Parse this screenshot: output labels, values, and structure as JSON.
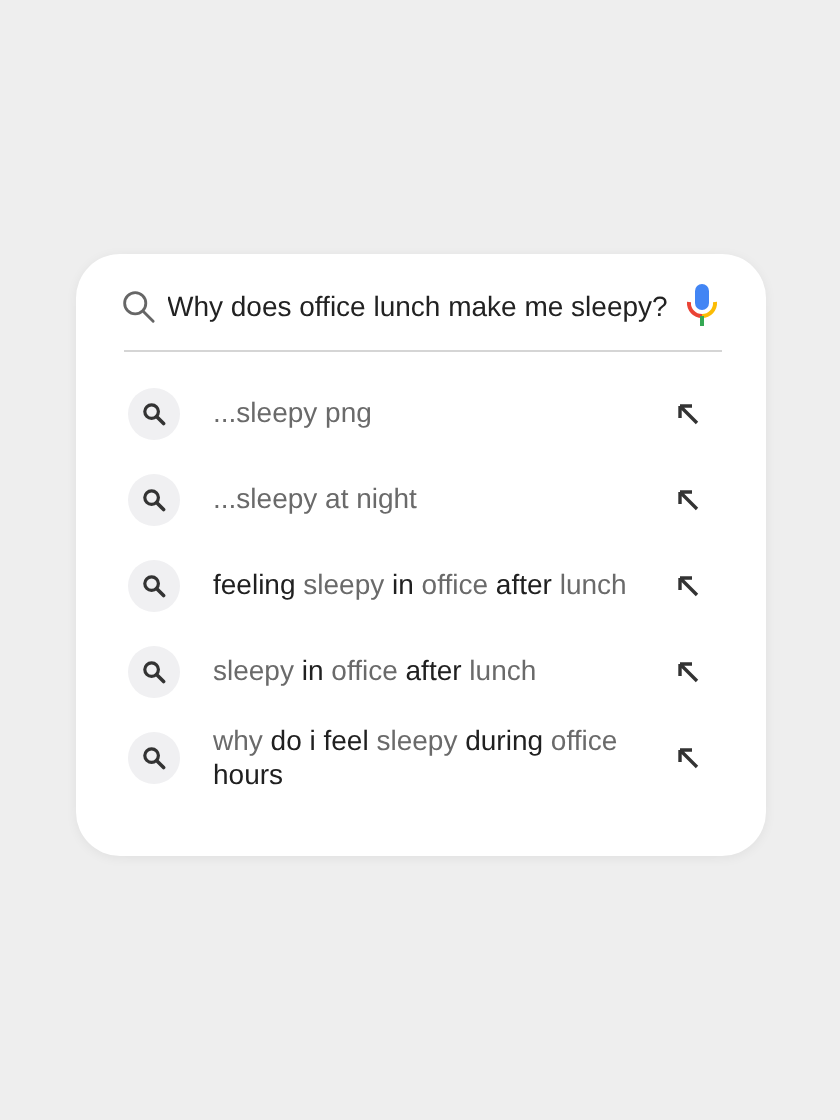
{
  "search": {
    "value": "Why does office lunch make me sleepy?"
  },
  "suggestions": [
    {
      "text": "...sleepy png"
    },
    {
      "text": "...sleepy at night"
    },
    {
      "text": "**feeling** sleepy **in** office **after** lunch"
    },
    {
      "text": "sleepy **in** office **after** lunch"
    },
    {
      "text": "why **do i feel** sleepy **during** office **hours**"
    }
  ]
}
